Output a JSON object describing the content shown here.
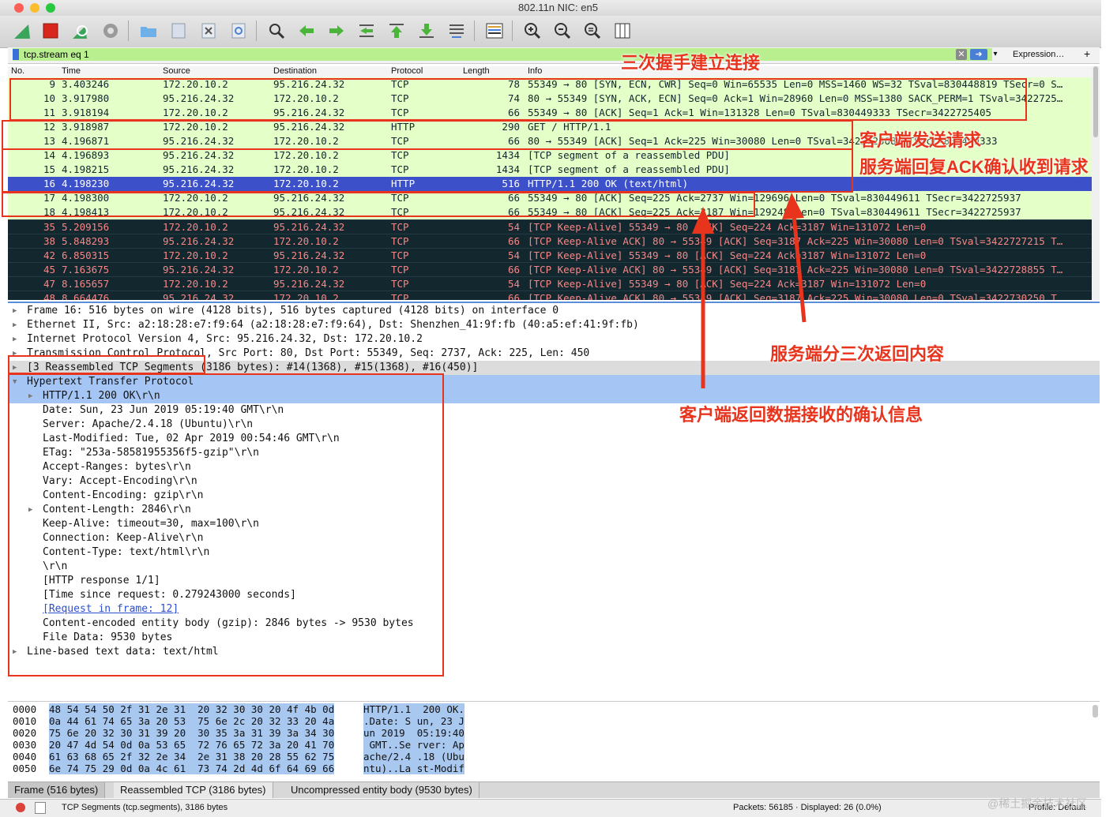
{
  "window": {
    "title": "802.11n NIC: en5"
  },
  "toolbar": {
    "icons": [
      "shark-fin-start-icon",
      "stop-capture-icon",
      "restart-capture-icon",
      "capture-options-icon",
      "open-file-icon",
      "save-file-icon",
      "close-file-icon",
      "reload-file-icon",
      "find-packet-icon",
      "go-back-icon",
      "go-forward-icon",
      "go-to-packet-icon",
      "go-first-icon",
      "go-last-icon",
      "autoscroll-icon",
      "colorize-icon",
      "zoom-in-icon",
      "zoom-out-icon",
      "zoom-normal-icon",
      "resize-columns-icon"
    ]
  },
  "filter": {
    "value": "tcp.stream eq 1",
    "expression_label": "Expression…",
    "add_label": "+"
  },
  "packet_list": {
    "headers": {
      "no": "No.",
      "time": "Time",
      "source": "Source",
      "destination": "Destination",
      "protocol": "Protocol",
      "length": "Length",
      "info": "Info"
    },
    "rows": [
      {
        "no": "9",
        "time": "3.403246",
        "src": "172.20.10.2",
        "dst": "95.216.24.32",
        "proto": "TCP",
        "len": "78",
        "info": "55349 → 80 [SYN, ECN, CWR] Seq=0 Win=65535 Len=0 MSS=1460 WS=32 TSval=830448819 TSecr=0 S…",
        "style": "green"
      },
      {
        "no": "10",
        "time": "3.917980",
        "src": "95.216.24.32",
        "dst": "172.20.10.2",
        "proto": "TCP",
        "len": "74",
        "info": "80 → 55349 [SYN, ACK, ECN] Seq=0 Ack=1 Win=28960 Len=0 MSS=1380 SACK_PERM=1 TSval=3422725…",
        "style": "green"
      },
      {
        "no": "11",
        "time": "3.918194",
        "src": "172.20.10.2",
        "dst": "95.216.24.32",
        "proto": "TCP",
        "len": "66",
        "info": "55349 → 80 [ACK] Seq=1 Ack=1 Win=131328 Len=0 TSval=830449333 TSecr=3422725405",
        "style": "green"
      },
      {
        "no": "12",
        "time": "3.918987",
        "src": "172.20.10.2",
        "dst": "95.216.24.32",
        "proto": "HTTP",
        "len": "290",
        "info": "GET / HTTP/1.1",
        "style": "green"
      },
      {
        "no": "13",
        "time": "4.196871",
        "src": "95.216.24.32",
        "dst": "172.20.10.2",
        "proto": "TCP",
        "len": "66",
        "info": "80 → 55349 [ACK] Seq=1 Ack=225 Win=30080 Len=0 TSval=3422725688 TSecr=830449333",
        "style": "green"
      },
      {
        "no": "14",
        "time": "4.196893",
        "src": "95.216.24.32",
        "dst": "172.20.10.2",
        "proto": "TCP",
        "len": "1434",
        "info": "[TCP segment of a reassembled PDU]",
        "style": "green"
      },
      {
        "no": "15",
        "time": "4.198215",
        "src": "95.216.24.32",
        "dst": "172.20.10.2",
        "proto": "TCP",
        "len": "1434",
        "info": "[TCP segment of a reassembled PDU]",
        "style": "green"
      },
      {
        "no": "16",
        "time": "4.198230",
        "src": "95.216.24.32",
        "dst": "172.20.10.2",
        "proto": "HTTP",
        "len": "516",
        "info": "HTTP/1.1 200 OK  (text/html)",
        "style": "selected"
      },
      {
        "no": "17",
        "time": "4.198300",
        "src": "172.20.10.2",
        "dst": "95.216.24.32",
        "proto": "TCP",
        "len": "66",
        "info": "55349 → 80 [ACK] Seq=225 Ack=2737 Win=129696 Len=0 TSval=830449611 TSecr=3422725937",
        "style": "green"
      },
      {
        "no": "18",
        "time": "4.198413",
        "src": "172.20.10.2",
        "dst": "95.216.24.32",
        "proto": "TCP",
        "len": "66",
        "info": "55349 → 80 [ACK] Seq=225 Ack=3187 Win=129248 Len=0 TSval=830449611 TSecr=3422725937",
        "style": "green"
      },
      {
        "no": "35",
        "time": "5.209156",
        "src": "172.20.10.2",
        "dst": "95.216.24.32",
        "proto": "TCP",
        "len": "54",
        "info": "[TCP Keep-Alive] 55349 → 80 [ACK] Seq=224 Ack=3187 Win=131072 Len=0",
        "style": "dark"
      },
      {
        "no": "38",
        "time": "5.848293",
        "src": "95.216.24.32",
        "dst": "172.20.10.2",
        "proto": "TCP",
        "len": "66",
        "info": "[TCP Keep-Alive ACK] 80 → 55349 [ACK] Seq=3187 Ack=225 Win=30080 Len=0 TSval=3422727215 T…",
        "style": "dark"
      },
      {
        "no": "42",
        "time": "6.850315",
        "src": "172.20.10.2",
        "dst": "95.216.24.32",
        "proto": "TCP",
        "len": "54",
        "info": "[TCP Keep-Alive] 55349 → 80 [ACK] Seq=224 Ack=3187 Win=131072 Len=0",
        "style": "dark"
      },
      {
        "no": "45",
        "time": "7.163675",
        "src": "95.216.24.32",
        "dst": "172.20.10.2",
        "proto": "TCP",
        "len": "66",
        "info": "[TCP Keep-Alive ACK] 80 → 55349 [ACK] Seq=3187 Ack=225 Win=30080 Len=0 TSval=3422728855 T…",
        "style": "dark"
      },
      {
        "no": "47",
        "time": "8.165657",
        "src": "172.20.10.2",
        "dst": "95.216.24.32",
        "proto": "TCP",
        "len": "54",
        "info": "[TCP Keep-Alive] 55349 → 80 [ACK] Seq=224 Ack=3187 Win=131072 Len=0",
        "style": "dark"
      },
      {
        "no": "48",
        "time": "8.664476",
        "src": "95.216.24.32",
        "dst": "172.20.10.2",
        "proto": "TCP",
        "len": "66",
        "info": "[TCP Keep-Alive ACK] 80 → 55349 [ACK] Seq=3187 Ack=225 Win=30080 Len=0 TSval=3422730250 T…",
        "style": "dark"
      }
    ]
  },
  "details": {
    "lines": [
      {
        "text": "Frame 16: 516 bytes on wire (4128 bits), 516 bytes captured (4128 bits) on interface 0",
        "indent": 0,
        "tri": "▶",
        "style": ""
      },
      {
        "text": "Ethernet II, Src: a2:18:28:e7:f9:64 (a2:18:28:e7:f9:64), Dst: Shenzhen_41:9f:fb (40:a5:ef:41:9f:fb)",
        "indent": 0,
        "tri": "▶",
        "style": ""
      },
      {
        "text": "Internet Protocol Version 4, Src: 95.216.24.32, Dst: 172.20.10.2",
        "indent": 0,
        "tri": "▶",
        "style": ""
      },
      {
        "text": "Transmission Control Protocol, Src Port: 80, Dst Port: 55349, Seq: 2737, Ack: 225, Len: 450",
        "indent": 0,
        "tri": "▶",
        "style": ""
      },
      {
        "text": "[3 Reassembled TCP Segments (3186 bytes): #14(1368), #15(1368), #16(450)]",
        "indent": 0,
        "tri": "▶",
        "style": "grey"
      },
      {
        "text": "Hypertext Transfer Protocol",
        "indent": 0,
        "tri": "▼",
        "style": "blue"
      },
      {
        "text": "HTTP/1.1 200 OK\\r\\n",
        "indent": 1,
        "tri": "▶",
        "style": "blue"
      },
      {
        "text": "Date: Sun, 23 Jun 2019 05:19:40 GMT\\r\\n",
        "indent": 1,
        "tri": "",
        "style": ""
      },
      {
        "text": "Server: Apache/2.4.18 (Ubuntu)\\r\\n",
        "indent": 1,
        "tri": "",
        "style": ""
      },
      {
        "text": "Last-Modified: Tue, 02 Apr 2019 00:54:46 GMT\\r\\n",
        "indent": 1,
        "tri": "",
        "style": ""
      },
      {
        "text": "ETag: \"253a-58581955356f5-gzip\"\\r\\n",
        "indent": 1,
        "tri": "",
        "style": ""
      },
      {
        "text": "Accept-Ranges: bytes\\r\\n",
        "indent": 1,
        "tri": "",
        "style": ""
      },
      {
        "text": "Vary: Accept-Encoding\\r\\n",
        "indent": 1,
        "tri": "",
        "style": ""
      },
      {
        "text": "Content-Encoding: gzip\\r\\n",
        "indent": 1,
        "tri": "",
        "style": ""
      },
      {
        "text": "Content-Length: 2846\\r\\n",
        "indent": 1,
        "tri": "▶",
        "style": ""
      },
      {
        "text": "Keep-Alive: timeout=30, max=100\\r\\n",
        "indent": 1,
        "tri": "",
        "style": ""
      },
      {
        "text": "Connection: Keep-Alive\\r\\n",
        "indent": 1,
        "tri": "",
        "style": ""
      },
      {
        "text": "Content-Type: text/html\\r\\n",
        "indent": 1,
        "tri": "",
        "style": ""
      },
      {
        "text": "\\r\\n",
        "indent": 1,
        "tri": "",
        "style": ""
      },
      {
        "text": "[HTTP response 1/1]",
        "indent": 1,
        "tri": "",
        "style": ""
      },
      {
        "text": "[Time since request: 0.279243000 seconds]",
        "indent": 1,
        "tri": "",
        "style": ""
      },
      {
        "text": "[Request in frame: 12]",
        "indent": 1,
        "tri": "",
        "style": "link"
      },
      {
        "text": "Content-encoded entity body (gzip): 2846 bytes -> 9530 bytes",
        "indent": 1,
        "tri": "",
        "style": ""
      },
      {
        "text": "File Data: 9530 bytes",
        "indent": 1,
        "tri": "",
        "style": ""
      },
      {
        "text": "Line-based text data: text/html",
        "indent": 0,
        "tri": "▶",
        "style": ""
      }
    ]
  },
  "bytes": {
    "rows": [
      {
        "off": "0000",
        "hex": "48 54 54 50 2f 31 2e 31  20 32 30 30 20 4f 4b 0d",
        "ascii": "HTTP/1.1  200 OK."
      },
      {
        "off": "0010",
        "hex": "0a 44 61 74 65 3a 20 53  75 6e 2c 20 32 33 20 4a",
        "ascii": ".Date: S un, 23 J"
      },
      {
        "off": "0020",
        "hex": "75 6e 20 32 30 31 39 20  30 35 3a 31 39 3a 34 30",
        "ascii": "un 2019  05:19:40"
      },
      {
        "off": "0030",
        "hex": "20 47 4d 54 0d 0a 53 65  72 76 65 72 3a 20 41 70",
        "ascii": " GMT..Se rver: Ap"
      },
      {
        "off": "0040",
        "hex": "61 63 68 65 2f 32 2e 34  2e 31 38 20 28 55 62 75",
        "ascii": "ache/2.4 .18 (Ubu"
      },
      {
        "off": "0050",
        "hex": "6e 74 75 29 0d 0a 4c 61  73 74 2d 4d 6f 64 69 66",
        "ascii": "ntu)..La st-Modif"
      }
    ],
    "tabs": [
      "Frame (516 bytes)",
      "Reassembled TCP (3186 bytes)",
      "Uncompressed entity body (9530 bytes)"
    ]
  },
  "status": {
    "left": "TCP Segments (tcp.segments), 3186 bytes",
    "packets": "Packets: 56185 · Displayed: 26 (0.0%)",
    "profile": "Profile: Default"
  },
  "annotations": {
    "handshake": "三次握手建立连接",
    "client_request": "客户端发送请求",
    "server_ack": "服务端回复ACK确认收到请求",
    "server_three": "服务端分三次返回内容",
    "client_ack": "客户端返回数据接收的确认信息",
    "color": "#e8341d"
  },
  "watermark": "@稀土掘金技术社区"
}
